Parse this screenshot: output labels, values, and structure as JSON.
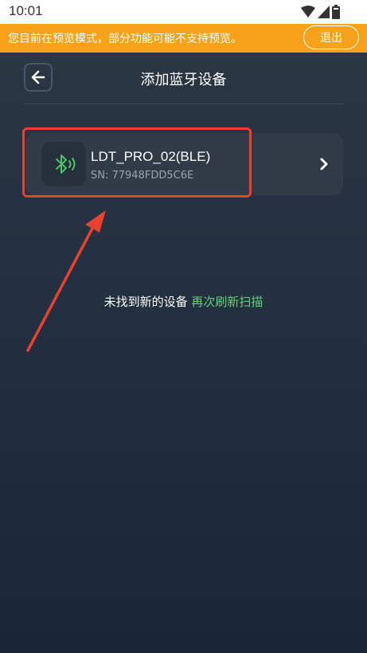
{
  "status_bar": {
    "time": "10:01",
    "icons": [
      "wifi-icon",
      "cellular-signal-icon",
      "battery-icon"
    ]
  },
  "banner": {
    "text": "您目前在预览模式，部分功能可能不支持预览。",
    "exit_label": "退出",
    "color": "#f7a21a"
  },
  "header": {
    "title": "添加蓝牙设备",
    "back_icon": "arrow-left-icon"
  },
  "devices": [
    {
      "name": "LDT_PRO_02(BLE)",
      "sn": "SN:  77948FDD5C6E",
      "icon": "bluetooth-icon",
      "action_icon": "chevron-right-icon"
    }
  ],
  "empty_state": {
    "message": "未找到新的设备",
    "rescan_label": "再次刷新扫描",
    "link_color": "#62d27a"
  },
  "annotation": {
    "color": "#e8412f"
  }
}
